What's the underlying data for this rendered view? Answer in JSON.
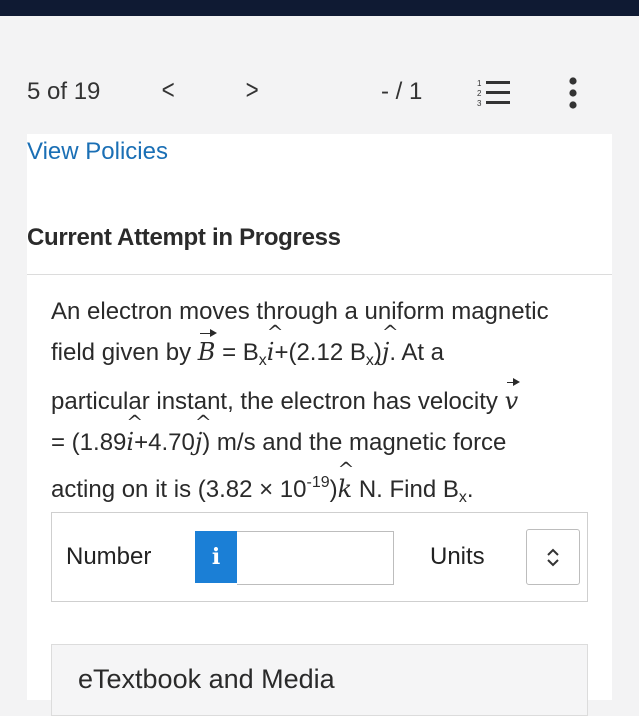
{
  "nav": {
    "counter": "5 of 19",
    "prev_symbol": "<",
    "next_symbol": ">",
    "score": "- / 1",
    "list_icon_digits": [
      "1",
      "2",
      "3"
    ]
  },
  "content": {
    "view_policies": "View Policies",
    "attempt_heading": "Current Attempt in Progress",
    "question": {
      "line1": "An electron moves through a uniform magnetic",
      "l2_a": "field given by ",
      "B": "B",
      "l2_b": " = B",
      "x": "x",
      "i": "i",
      "l2_c": "+(2.12 B",
      "l2_d": ")",
      "j": "j",
      "l2_e": ". At a",
      "l3_a": "particular instant, the electron has velocity ",
      "v": "v",
      "l4_a": "= (1.89",
      "l4_b": "+4.70",
      "l4_c": ") m/s and the magnetic force",
      "l5_a": "acting on it is (3.82 × 10",
      "exp": "-19",
      "l5_b": ")",
      "k": "k",
      "l5_c": " N. Find B",
      "l5_d": "."
    }
  },
  "answer": {
    "number_label": "Number",
    "info_glyph": "i",
    "number_value": "",
    "units_label": "Units",
    "info_color": "#1b7fd6"
  },
  "etextbook": {
    "label": "eTextbook and Media"
  }
}
